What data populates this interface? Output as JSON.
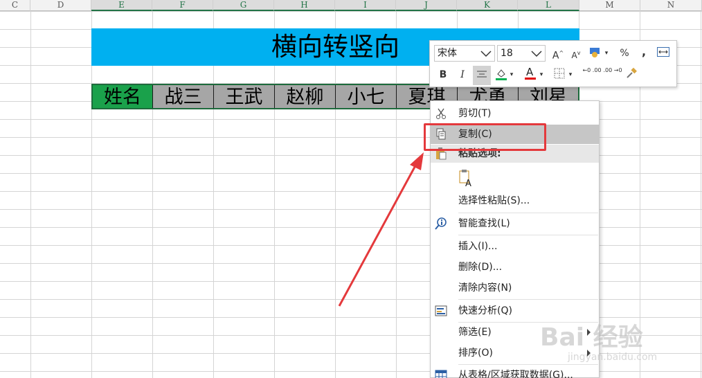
{
  "spreadsheet": {
    "column_headers": [
      "C",
      "D",
      "E",
      "F",
      "G",
      "H",
      "I",
      "J",
      "K",
      "L",
      "M",
      "N"
    ],
    "title_cell": "横向转竖向",
    "data_row": [
      "姓名",
      "战三",
      "王武",
      "赵柳",
      "小七",
      "夏琪",
      "尤勇",
      "刘星"
    ]
  },
  "mini_toolbar": {
    "font_name": "宋体",
    "font_size": "18",
    "grow_font": "A",
    "shrink_font": "A",
    "percent": "%",
    "comma": ",",
    "bold": "B",
    "italic": "I",
    "increase_decimal": "←0 .00",
    "decrease_decimal": ".00 →0",
    "colors": {
      "fill": "#00b050",
      "font": "#e00000"
    }
  },
  "context_menu": {
    "items": [
      {
        "label": "剪切(T)",
        "icon": "scissors-icon"
      },
      {
        "label": "复制(C)",
        "icon": "copy-icon"
      },
      {
        "label": "粘贴选项:",
        "icon": "paste-icon"
      },
      {
        "label": "A",
        "icon": "paste-clipboard-icon"
      },
      {
        "label": "选择性粘贴(S)...",
        "icon": ""
      },
      {
        "label": "智能查找(L)",
        "icon": "smart-lookup-icon"
      },
      {
        "label": "插入(I)...",
        "icon": ""
      },
      {
        "label": "删除(D)...",
        "icon": ""
      },
      {
        "label": "清除内容(N)",
        "icon": ""
      },
      {
        "label": "快速分析(Q)",
        "icon": "quick-analysis-icon"
      },
      {
        "label": "筛选(E)",
        "icon": ""
      },
      {
        "label": "排序(O)",
        "icon": ""
      },
      {
        "label": "从表格/区域获取数据(G)...",
        "icon": "table-icon"
      }
    ]
  },
  "watermark": {
    "main": "Bai 经验",
    "sub": "jingyan.baidu.com"
  },
  "colors": {
    "title_band": "#00b0f0",
    "first_cell": "#1aa14b",
    "row_fill": "#a6a6a6",
    "highlight_box": "#e4393c"
  }
}
